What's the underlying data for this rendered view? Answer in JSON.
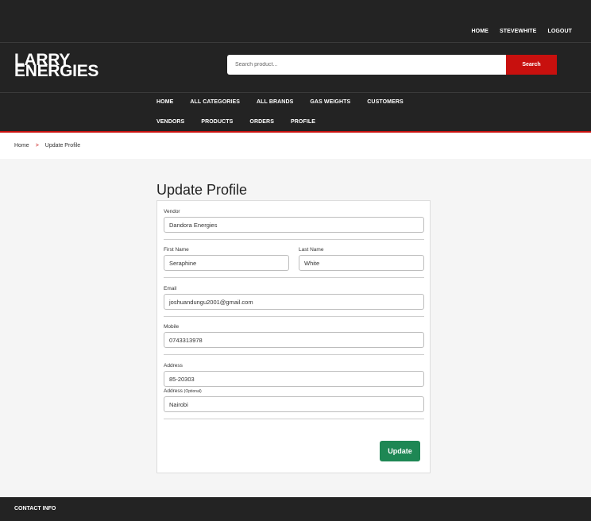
{
  "topbar": {
    "links": [
      "HOME",
      "STEVEWHITE",
      "LOGOUT"
    ]
  },
  "header": {
    "logo_line1": "LARRY",
    "logo_line2": "ENERGIES",
    "search_placeholder": "Search product...",
    "search_button": "Search"
  },
  "nav": {
    "row1": [
      "HOME",
      "ALL CATEGORIES",
      "ALL BRANDS",
      "GAS WEIGHTS",
      "CUSTOMERS"
    ],
    "row2": [
      "VENDORS",
      "PRODUCTS",
      "ORDERS",
      "PROFILE"
    ]
  },
  "breadcrumb": {
    "home": "Home",
    "separator": ">",
    "current": "Update Profile"
  },
  "form": {
    "title": "Update Profile",
    "vendor_label": "Vendor",
    "vendor_value": "Dandora Energies",
    "first_name_label": "First Name",
    "first_name_value": "Seraphine",
    "last_name_label": "Last Name",
    "last_name_value": "White",
    "email_label": "Email",
    "email_value": "joshuandungu2001@gmail.com",
    "mobile_label": "Mobile",
    "mobile_value": "0743313978",
    "address_label": "Address",
    "address_value": "85-20303",
    "address2_label": "Address",
    "address2_optional": "(Optional)",
    "address2_value": "Nairobi",
    "submit_label": "Update"
  },
  "footer": {
    "title": "CONTACT INFO"
  },
  "colors": {
    "dark": "#232323",
    "accent": "#c8100e",
    "submit": "#1e8754"
  }
}
